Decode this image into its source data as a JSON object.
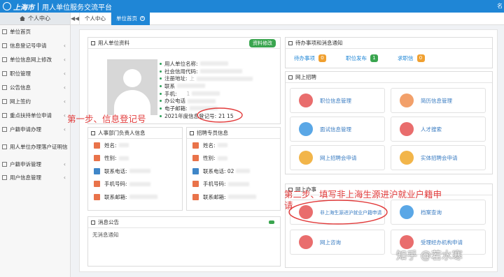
{
  "header": {
    "logo_text": "上海市",
    "app_title": "用人单位服务交流平台",
    "right_text": "名"
  },
  "sidebar": {
    "head": "个人中心",
    "items": [
      {
        "label": "单位首页",
        "arrow": ""
      },
      {
        "label": "信息登记号申请",
        "arrow": "‹"
      },
      {
        "label": "单位信息网上修改",
        "arrow": "‹"
      },
      {
        "label": "职位管理",
        "arrow": "‹"
      },
      {
        "label": "公告信息",
        "arrow": "‹"
      },
      {
        "label": "网上签约",
        "arrow": "‹"
      },
      {
        "label": "重点扶持单位申请",
        "arrow": "‹"
      },
      {
        "label": "户籍申请办理",
        "arrow": "‹"
      },
      {
        "label": "用人单位办理落户证明信",
        "arrow": ""
      },
      {
        "label": "户籍申诉管理",
        "arrow": "‹"
      },
      {
        "label": "用户信息管理",
        "arrow": "‹"
      }
    ]
  },
  "tabs": {
    "nav_left": "◀◀",
    "items": [
      {
        "label": "个人中心"
      },
      {
        "label": "单位首页",
        "close": "×"
      }
    ]
  },
  "unit_info": {
    "title": "用人单位资料",
    "edit_button": "资料修改",
    "fields": [
      {
        "label": "用人单位名称:",
        "value": ""
      },
      {
        "label": "社会信用代码:",
        "value": ""
      },
      {
        "label": "注册地址:",
        "value": "上"
      },
      {
        "label": "联系",
        "value": ""
      },
      {
        "label": "手机:",
        "value": "1"
      },
      {
        "label": "办公电话",
        "value": ""
      },
      {
        "label": "电子邮箱:",
        "value": ""
      },
      {
        "label": "2021年度信息登记号:",
        "value": "21 15"
      }
    ]
  },
  "hr_contact": {
    "title": "人事部门负责人信息",
    "rows": [
      {
        "label": "姓名:",
        "color": "#e9734a"
      },
      {
        "label": "性别:",
        "color": "#e9734a"
      },
      {
        "label": "联系电话:",
        "color": "#3f86c8"
      },
      {
        "label": "手机号码:",
        "color": "#e9734a"
      },
      {
        "label": "联系邮箱:",
        "color": "#e9734a"
      }
    ]
  },
  "recruit_contact": {
    "title": "招聘专员信息",
    "rows": [
      {
        "label": "姓名:",
        "color": "#e9734a"
      },
      {
        "label": "性别:",
        "color": "#e9734a"
      },
      {
        "label": "联系电话: 02",
        "color": "#3f86c8"
      },
      {
        "label": "手机号码:",
        "color": "#e9734a"
      },
      {
        "label": "联系邮箱:",
        "color": "#e9734a"
      }
    ]
  },
  "pending": {
    "title": "待办事项和消息通知",
    "items": [
      {
        "label": "待办事项",
        "count": "0",
        "color": "#f0a030"
      },
      {
        "label": "职位发布",
        "count": "1",
        "color": "#3aa54f"
      },
      {
        "label": "求职信",
        "count": "0",
        "color": "#f0a030"
      }
    ]
  },
  "recruit": {
    "title": "网上招聘",
    "tiles": [
      {
        "label": "职位信息管理",
        "color": "#e96d6d"
      },
      {
        "label": "简历信息管理",
        "color": "#f2a06a"
      },
      {
        "label": "面试信息管理",
        "color": "#5aa7e6"
      },
      {
        "label": "人才搜索",
        "color": "#e96d6d"
      },
      {
        "label": "网上招聘会申请",
        "color": "#f2b54a"
      },
      {
        "label": "实体招聘会申请",
        "color": "#f2b54a"
      }
    ]
  },
  "online_office": {
    "title": "网上办事",
    "tiles": [
      {
        "label": "非上海生源进沪就业户籍申请",
        "color": "#e96d6d"
      },
      {
        "label": "档案查询",
        "color": "#5aa7e6"
      },
      {
        "label": "网上咨询",
        "color": "#e96d6d"
      },
      {
        "label": "受理经办机构申请",
        "color": "#e96d6d"
      }
    ]
  },
  "notice": {
    "title": "消息公告",
    "empty": "无消息通知"
  },
  "annotations": {
    "step1": "第一步、信息登记号",
    "step2_line1": "第二步、填写非上海生源进沪就业户籍申",
    "step2_line2": "请",
    "color": "#e23b3b"
  },
  "watermark": "知乎 @若水寒"
}
